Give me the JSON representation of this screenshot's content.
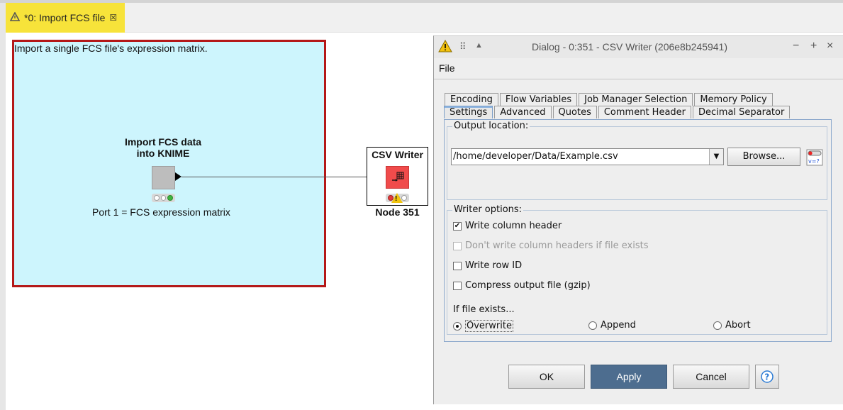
{
  "editor_tab": {
    "title": "*0: Import FCS file",
    "close_glyph": "☒"
  },
  "canvas": {
    "annotation_text": "Import a single FCS file's expression matrix.",
    "node1": {
      "title_line1": "Import FCS data",
      "title_line2": "into KNIME",
      "port_text": "Port 1 = FCS expression matrix"
    },
    "node2": {
      "title": "CSV Writer",
      "label": "Node 351"
    },
    "colors": {
      "annotation_bg": "#cdf5fd",
      "annotation_border": "#b41818",
      "tab_bg": "#f7e33a",
      "writer_icon": "#f04b4b"
    }
  },
  "dialog": {
    "title": "Dialog - 0:351 - CSV Writer  (206e8b245941)",
    "controls": [
      "−",
      "+",
      "×"
    ],
    "menu": "File",
    "tabs_row1": [
      "Encoding",
      "Flow Variables",
      "Job Manager Selection",
      "Memory Policy"
    ],
    "tabs_row2": [
      "Settings",
      "Advanced",
      "Quotes",
      "Comment Header",
      "Decimal Separator"
    ],
    "active_tab": "Settings",
    "output_location": {
      "legend": "Output location:",
      "path": "/home/developer/Data/Example.csv",
      "browse": "Browse..."
    },
    "writer_options": {
      "legend": "Writer options:",
      "write_column_header": "Write column header",
      "dont_write_headers": "Don't write column headers if file exists",
      "write_row_id": "Write row ID",
      "compress": "Compress output file (gzip)",
      "if_exists_label": "If file exists...",
      "overwrite": "Overwrite",
      "append": "Append",
      "abort": "Abort"
    },
    "buttons": {
      "ok": "OK",
      "apply": "Apply",
      "cancel": "Cancel"
    },
    "accent": "#4d6d8f"
  }
}
